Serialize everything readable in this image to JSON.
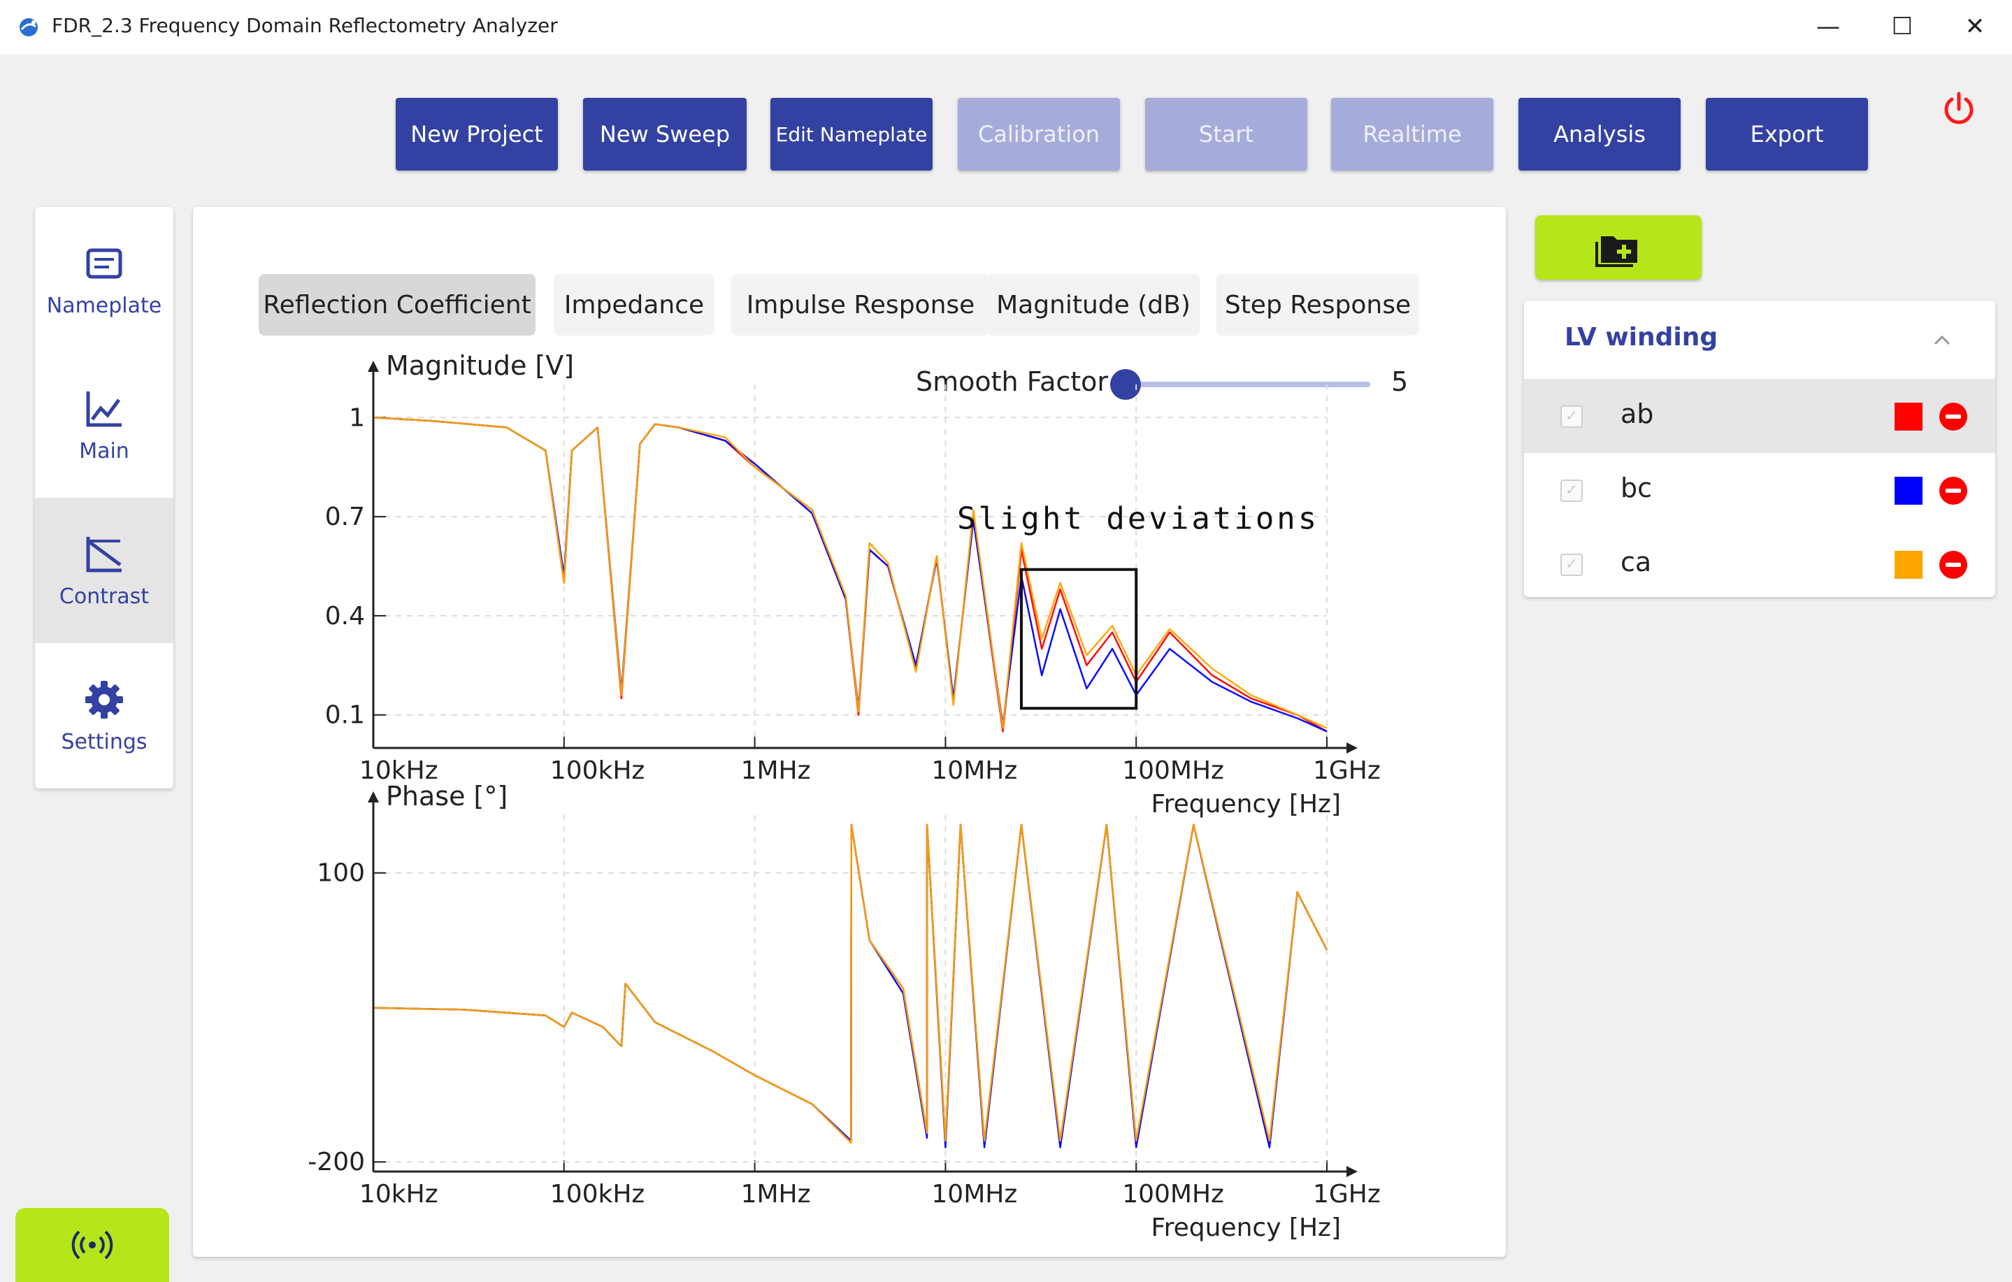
{
  "window": {
    "title": "FDR_2.3 Frequency Domain Reflectometry Analyzer",
    "controls": [
      "—",
      "☐",
      "✕"
    ]
  },
  "toolbar": {
    "buttons": [
      {
        "label": "New Project",
        "state": "enabled"
      },
      {
        "label": "New Sweep",
        "state": "enabled"
      },
      {
        "label": "Edit Nameplate",
        "state": "enabled"
      },
      {
        "label": "Calibration",
        "state": "disabled"
      },
      {
        "label": "Start",
        "state": "disabled"
      },
      {
        "label": "Realtime",
        "state": "disabled"
      },
      {
        "label": "Analysis",
        "state": "enabled"
      },
      {
        "label": "Export",
        "state": "enabled"
      }
    ]
  },
  "sidebar": {
    "items": [
      {
        "label": "Nameplate",
        "icon": "nameplate-icon",
        "selected": false
      },
      {
        "label": "Main",
        "icon": "line-chart-icon",
        "selected": false
      },
      {
        "label": "Contrast",
        "icon": "contrast-icon",
        "selected": true
      },
      {
        "label": "Settings",
        "icon": "gear-icon",
        "selected": false
      }
    ]
  },
  "tabs": [
    {
      "label": "Reflection Coefficient",
      "selected": true
    },
    {
      "label": "Impedance",
      "selected": false
    },
    {
      "label": "Impulse Response",
      "selected": false
    },
    {
      "label": "Magnitude (dB)",
      "selected": false
    },
    {
      "label": "Step Response",
      "selected": false
    }
  ],
  "smooth": {
    "label": "Smooth Factor",
    "value": "5",
    "fraction": 0.0
  },
  "winding_panel": {
    "title": "LV winding",
    "rows": [
      {
        "label": "ab",
        "color": "#ff0000",
        "checked": true,
        "highlighted": true
      },
      {
        "label": "bc",
        "color": "#0000ff",
        "checked": true,
        "highlighted": false
      },
      {
        "label": "ca",
        "color": "#ffa500",
        "checked": true,
        "highlighted": false
      }
    ]
  },
  "colors": {
    "accent": "#3342a2",
    "accent_disabled": "#a6acd9",
    "lime": "#b6e61a"
  },
  "chart_data": [
    {
      "type": "line",
      "ylabel": "Magnitude [V]",
      "xlabel": "Frequency [Hz]",
      "xscale": "log",
      "xlim": [
        10000,
        1000000000
      ],
      "ylim": [
        0,
        1.1
      ],
      "yticks": [
        1,
        0.7,
        0.4,
        0.1
      ],
      "ytick_labels": [
        "1",
        "0.7",
        "0.4",
        "0.1"
      ],
      "xtick_labels": [
        "10kHz",
        "100kHz",
        "1MHz",
        "10MHz",
        "100MHz",
        "1GHz"
      ],
      "grid": true,
      "annotation": {
        "text": "Slight deviations",
        "x_range": [
          25000000,
          100000000
        ],
        "y_range": [
          0.12,
          0.54
        ]
      },
      "series": [
        {
          "color": "#ff0000",
          "x": [
            10000,
            20000,
            50000,
            80000,
            100000,
            110000,
            150000,
            200000,
            250000,
            300000,
            400000,
            700000,
            1000000,
            2000000,
            3000000,
            3500000,
            4000000,
            5000000,
            7000000,
            9000000,
            11000000,
            14000000,
            20000000,
            25000000,
            32000000,
            40000000,
            55000000,
            75000000,
            100000000,
            150000000,
            250000000,
            400000000,
            700000000,
            1000000000
          ],
          "y": [
            1.0,
            0.99,
            0.97,
            0.9,
            0.5,
            0.9,
            0.97,
            0.15,
            0.92,
            0.98,
            0.97,
            0.93,
            0.85,
            0.72,
            0.45,
            0.1,
            0.6,
            0.55,
            0.24,
            0.58,
            0.14,
            0.7,
            0.05,
            0.6,
            0.3,
            0.48,
            0.25,
            0.35,
            0.2,
            0.35,
            0.22,
            0.15,
            0.1,
            0.05
          ]
        },
        {
          "color": "#0000ff",
          "x": [
            10000,
            20000,
            50000,
            80000,
            100000,
            110000,
            150000,
            200000,
            250000,
            300000,
            400000,
            700000,
            1000000,
            2000000,
            3000000,
            3500000,
            4000000,
            5000000,
            7000000,
            9000000,
            11000000,
            14000000,
            20000000,
            25000000,
            32000000,
            40000000,
            55000000,
            75000000,
            100000000,
            150000000,
            250000000,
            400000000,
            700000000,
            1000000000
          ],
          "y": [
            1.0,
            0.99,
            0.97,
            0.9,
            0.52,
            0.9,
            0.97,
            0.17,
            0.92,
            0.98,
            0.97,
            0.93,
            0.86,
            0.71,
            0.45,
            0.12,
            0.6,
            0.55,
            0.25,
            0.57,
            0.15,
            0.69,
            0.07,
            0.52,
            0.22,
            0.42,
            0.18,
            0.3,
            0.16,
            0.3,
            0.2,
            0.14,
            0.09,
            0.05
          ]
        },
        {
          "color": "#ffa500",
          "x": [
            10000,
            20000,
            50000,
            80000,
            100000,
            110000,
            150000,
            200000,
            250000,
            300000,
            400000,
            700000,
            1000000,
            2000000,
            3000000,
            3500000,
            4000000,
            5000000,
            7000000,
            9000000,
            11000000,
            14000000,
            20000000,
            25000000,
            32000000,
            40000000,
            55000000,
            75000000,
            100000000,
            150000000,
            250000000,
            400000000,
            700000000,
            1000000000
          ],
          "y": [
            1.0,
            0.99,
            0.97,
            0.9,
            0.5,
            0.9,
            0.97,
            0.16,
            0.92,
            0.98,
            0.97,
            0.94,
            0.85,
            0.72,
            0.46,
            0.11,
            0.62,
            0.56,
            0.23,
            0.58,
            0.13,
            0.72,
            0.06,
            0.62,
            0.33,
            0.5,
            0.28,
            0.37,
            0.22,
            0.36,
            0.24,
            0.16,
            0.1,
            0.06
          ]
        }
      ]
    },
    {
      "type": "line",
      "ylabel": "Phase [°]",
      "xlabel": "Frequency [Hz]",
      "xscale": "log",
      "xlim": [
        10000,
        1000000000
      ],
      "ylim": [
        -210,
        160
      ],
      "yticks": [
        100,
        -200
      ],
      "ytick_labels": [
        "100",
        "-200"
      ],
      "xtick_labels": [
        "10kHz",
        "100kHz",
        "1MHz",
        "10MHz",
        "100MHz",
        "1GHz"
      ],
      "grid": true,
      "series": [
        {
          "color": "#ff0000",
          "x": [
            10000,
            30000,
            80000,
            100000,
            110000,
            160000,
            200000,
            210000,
            300000,
            600000,
            1000000,
            2000000,
            3200000,
            3210000,
            4000000,
            6000000,
            8000000,
            8010000,
            10000000,
            12000000,
            16000000,
            25000000,
            40000000,
            70000000,
            100000000,
            200000000,
            500000000,
            700000000,
            1000000000
          ],
          "y": [
            -40,
            -42,
            -48,
            -60,
            -45,
            -60,
            -80,
            -15,
            -55,
            -85,
            -110,
            -140,
            -180,
            150,
            30,
            -20,
            -170,
            150,
            -180,
            150,
            -180,
            150,
            -180,
            150,
            -180,
            150,
            -180,
            80,
            20
          ]
        },
        {
          "color": "#0000ff",
          "x": [
            10000,
            30000,
            80000,
            100000,
            110000,
            160000,
            200000,
            210000,
            300000,
            600000,
            1000000,
            2000000,
            3200000,
            3210000,
            4000000,
            6000000,
            8000000,
            8010000,
            10000000,
            12000000,
            16000000,
            25000000,
            40000000,
            70000000,
            100000000,
            200000000,
            500000000,
            700000000,
            1000000000
          ],
          "y": [
            -40,
            -42,
            -48,
            -60,
            -45,
            -60,
            -80,
            -15,
            -55,
            -85,
            -110,
            -140,
            -178,
            150,
            30,
            -25,
            -175,
            150,
            -185,
            150,
            -185,
            150,
            -185,
            150,
            -185,
            150,
            -185,
            80,
            20
          ]
        },
        {
          "color": "#ffa500",
          "x": [
            10000,
            30000,
            80000,
            100000,
            110000,
            160000,
            200000,
            210000,
            300000,
            600000,
            1000000,
            2000000,
            3200000,
            3210000,
            4000000,
            6000000,
            8000000,
            8010000,
            10000000,
            12000000,
            16000000,
            25000000,
            40000000,
            70000000,
            100000000,
            200000000,
            500000000,
            700000000,
            1000000000
          ],
          "y": [
            -40,
            -42,
            -48,
            -60,
            -45,
            -60,
            -80,
            -15,
            -55,
            -85,
            -110,
            -140,
            -180,
            150,
            30,
            -20,
            -170,
            150,
            -178,
            150,
            -178,
            150,
            -178,
            150,
            -178,
            150,
            -178,
            80,
            20
          ]
        }
      ]
    }
  ]
}
